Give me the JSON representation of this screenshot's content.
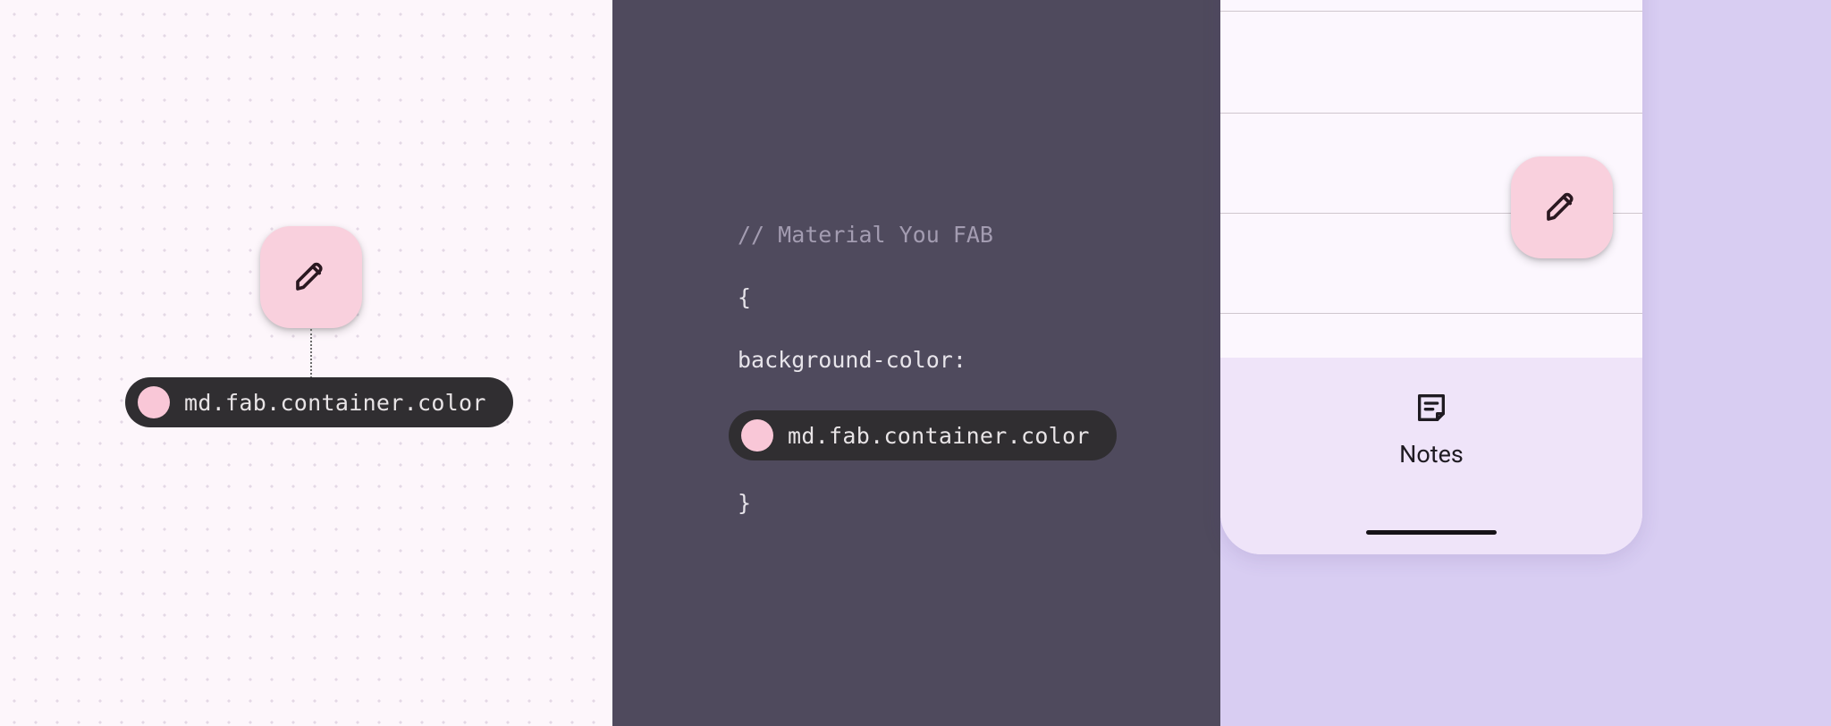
{
  "design_panel": {
    "token_name": "md.fab.container.color",
    "swatch_color": "#f9c7d7"
  },
  "code_panel": {
    "comment": "// Material You FAB",
    "brace_open": "{",
    "property": "background-color:",
    "token_name": "md.fab.container.color",
    "swatch_color": "#f9c7d7",
    "brace_close": "}"
  },
  "app_panel": {
    "nav_label": "Notes"
  }
}
